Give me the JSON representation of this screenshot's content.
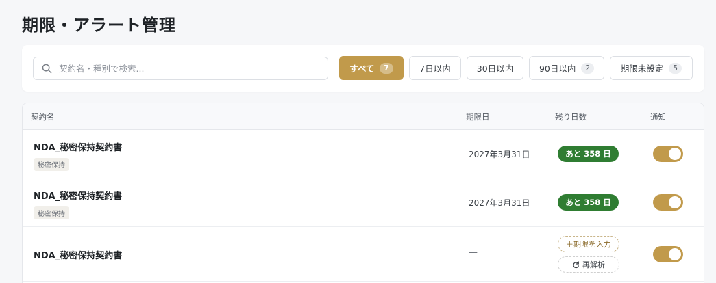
{
  "page": {
    "title": "期限・アラート管理"
  },
  "search": {
    "placeholder": "契約名・種別で検索..."
  },
  "filters": [
    {
      "label": "すべて",
      "count": "7",
      "active": true
    },
    {
      "label": "7日以内",
      "count": "",
      "active": false
    },
    {
      "label": "30日以内",
      "count": "",
      "active": false
    },
    {
      "label": "90日以内",
      "count": "2",
      "active": false
    },
    {
      "label": "期限未設定",
      "count": "5",
      "active": false
    }
  ],
  "table": {
    "headers": {
      "name": "契約名",
      "due": "期限日",
      "remaining": "残り日数",
      "notify": "通知"
    },
    "rows": [
      {
        "name": "NDA_秘密保持契約書",
        "tag": "秘密保持",
        "due": "2027年3月31日",
        "remaining": "あと 358 日",
        "notify": true
      },
      {
        "name": "NDA_秘密保持契約書",
        "tag": "秘密保持",
        "due": "2027年3月31日",
        "remaining": "あと 358 日",
        "notify": true
      },
      {
        "name": "NDA_秘密保持契約書",
        "tag": "",
        "due": "—",
        "set_due_label": "＋期限を入力",
        "reanalyze_label": "再解析",
        "notify": true
      }
    ]
  },
  "colors": {
    "accent": "#c19a4b",
    "success": "#2f7d32"
  },
  "icons": {
    "search": "search-icon",
    "refresh": "refresh-icon",
    "plus": "plus-icon"
  }
}
